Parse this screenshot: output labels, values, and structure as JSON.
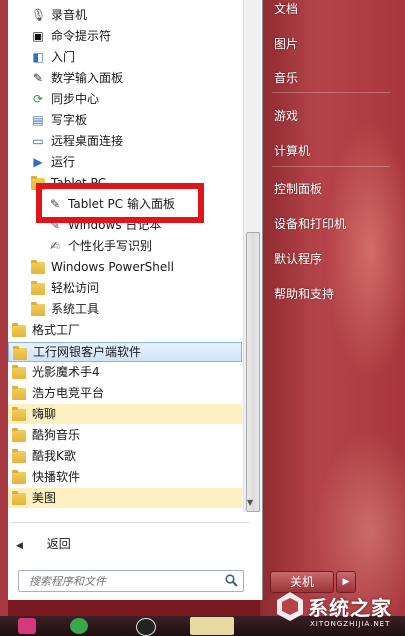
{
  "left_menu": {
    "items": [
      {
        "label": "录音机",
        "icon": "microphone-icon",
        "indent": 1
      },
      {
        "label": "命令提示符",
        "icon": "command-prompt-icon",
        "indent": 1
      },
      {
        "label": "入门",
        "icon": "getting-started-icon",
        "indent": 1
      },
      {
        "label": "数学输入面板",
        "icon": "math-input-icon",
        "indent": 1
      },
      {
        "label": "同步中心",
        "icon": "sync-center-icon",
        "indent": 1
      },
      {
        "label": "写字板",
        "icon": "wordpad-icon",
        "indent": 1
      },
      {
        "label": "远程桌面连接",
        "icon": "remote-desktop-icon",
        "indent": 1
      },
      {
        "label": "运行",
        "icon": "run-icon",
        "indent": 1
      },
      {
        "label": "Tablet PC",
        "icon": "folder-icon",
        "indent": 1
      },
      {
        "label": "Tablet PC 输入面板",
        "icon": "pen-icon",
        "indent": 2
      },
      {
        "label": "Windows 日记本",
        "icon": "journal-icon",
        "indent": 2
      },
      {
        "label": "个性化手写识别",
        "icon": "handwriting-icon",
        "indent": 2
      },
      {
        "label": "Windows PowerShell",
        "icon": "folder-icon",
        "indent": 1
      },
      {
        "label": "轻松访问",
        "icon": "folder-icon",
        "indent": 1
      },
      {
        "label": "系统工具",
        "icon": "folder-icon",
        "indent": 1
      },
      {
        "label": "格式工厂",
        "icon": "folder-icon",
        "indent": 0
      },
      {
        "label": "工行网银客户端软件",
        "icon": "folder-icon",
        "indent": 0,
        "highlight": "blue"
      },
      {
        "label": "光影魔术手4",
        "icon": "folder-icon",
        "indent": 0
      },
      {
        "label": "浩方电竞平台",
        "icon": "folder-icon",
        "indent": 0
      },
      {
        "label": "嗨聊",
        "icon": "folder-icon",
        "indent": 0,
        "highlight": "yellow"
      },
      {
        "label": "酷狗音乐",
        "icon": "folder-icon",
        "indent": 0
      },
      {
        "label": "酷我K歌",
        "icon": "folder-icon",
        "indent": 0
      },
      {
        "label": "快播软件",
        "icon": "folder-icon",
        "indent": 0
      },
      {
        "label": "美图",
        "icon": "folder-icon",
        "indent": 0,
        "highlight": "yellow"
      }
    ],
    "back_label": "返回",
    "search_placeholder": "搜索程序和文件"
  },
  "right_menu": {
    "items": [
      "文档",
      "图片",
      "音乐",
      "游戏",
      "计算机",
      "控制面板",
      "设备和打印机",
      "默认程序",
      "帮助和支持"
    ]
  },
  "shutdown": {
    "label": "关机"
  },
  "watermark": {
    "name": "系统之家",
    "url": "XITONGZHIJIA.NET"
  },
  "colors": {
    "annotation_red": "#e0141b",
    "right_pane": "#a8363c",
    "folder": "#e4b33b"
  }
}
